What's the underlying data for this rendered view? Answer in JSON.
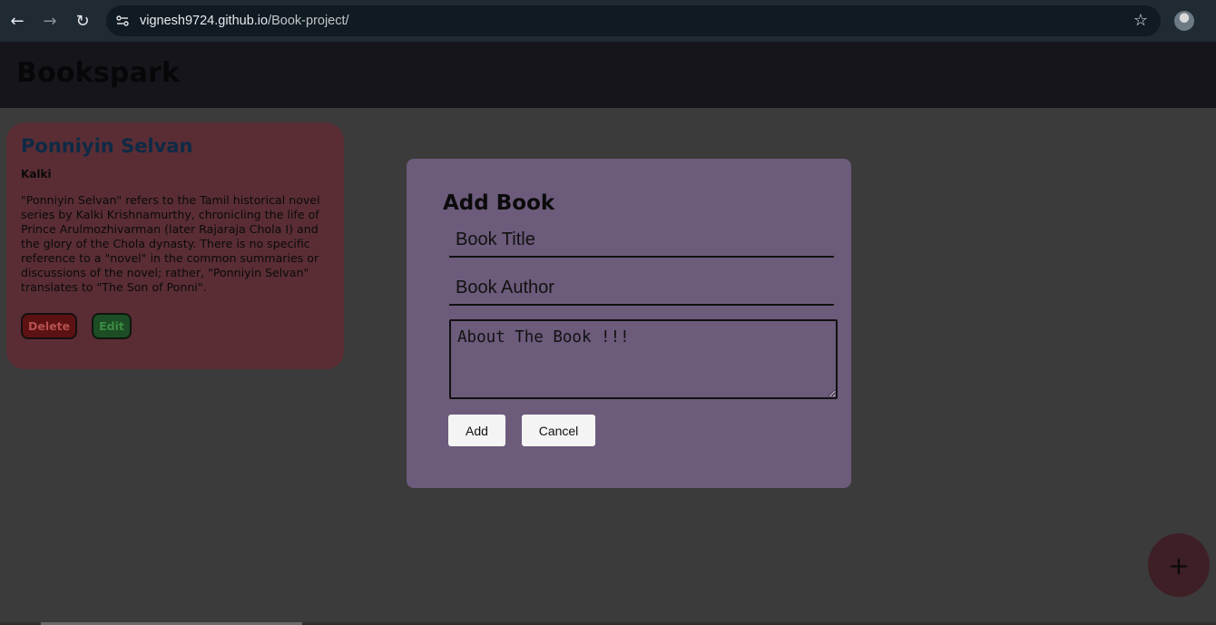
{
  "browser": {
    "back_icon": "arrow-left-icon",
    "forward_icon": "arrow-right-icon",
    "reload_icon": "reload-icon",
    "url_host": "vignesh9724.github.io",
    "url_path": "/Book-project/",
    "bookmark_icon": "star-icon"
  },
  "app": {
    "title": "Bookspark"
  },
  "book_card": {
    "title": "Ponniyin Selvan",
    "author": "Kalki",
    "description": "\"Ponniyin Selvan\" refers to the Tamil historical novel series by Kalki Krishnamurthy, chronicling the life of Prince Arulmozhivarman (later Rajaraja Chola I) and the glory of the Chola dynasty. There is no specific reference to a \"novel\" in the common summaries or discussions of the novel; rather, \"Ponniyin Selvan\" translates to \"The Son of Ponni\".",
    "delete_label": "Delete",
    "edit_label": "Edit"
  },
  "modal": {
    "title": "Add Book",
    "title_placeholder": "Book Title",
    "author_placeholder": "Book Author",
    "about_placeholder": "About The Book !!!",
    "add_label": "Add",
    "cancel_label": "Cancel"
  },
  "fab": {
    "label": "+"
  },
  "colors": {
    "modal_bg": "#6c5b7b",
    "card_bg": "#5a2d35",
    "header_bg": "#17151c",
    "page_bg": "#3b3b3b"
  }
}
